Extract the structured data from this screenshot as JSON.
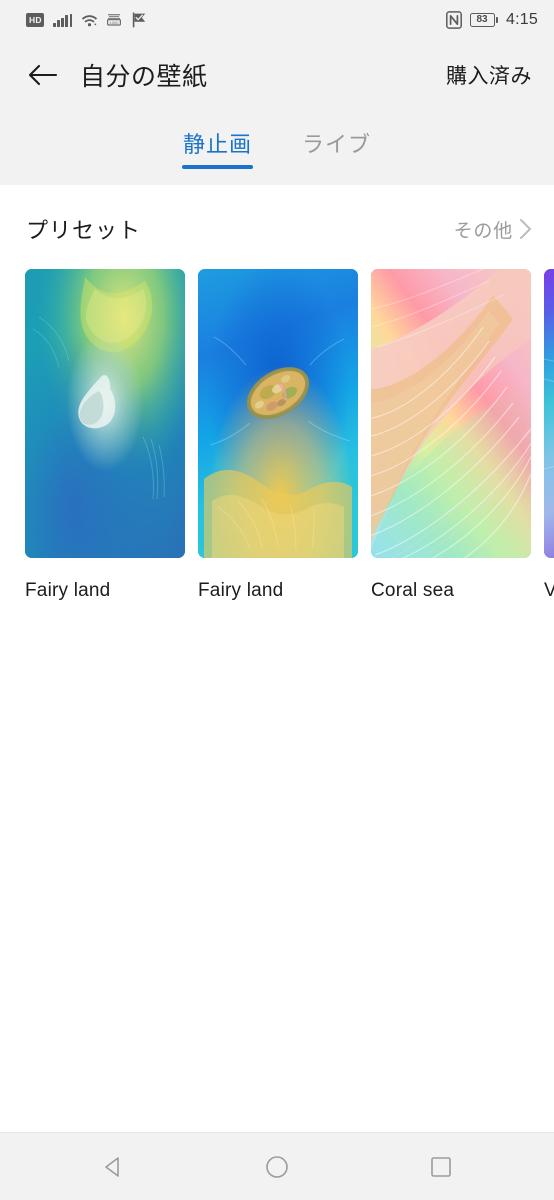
{
  "status_bar": {
    "hd_label": "HD",
    "icons": [
      "hd-badge",
      "signal-bars-icon",
      "wifi-icon",
      "vpn-key-icon",
      "flag-check-icon",
      "nfc-icon"
    ],
    "battery_percent": "83",
    "time": "4:15"
  },
  "app_bar": {
    "back_icon": "back-arrow-icon",
    "title": "自分の壁紙",
    "action_label": "購入済み"
  },
  "tabs": [
    {
      "label": "静止画",
      "active": true
    },
    {
      "label": "ライブ",
      "active": false
    }
  ],
  "section": {
    "title": "プリセット",
    "more_label": "その他",
    "more_icon": "chevron-right-icon"
  },
  "wallpapers": [
    {
      "label": "Fairy land",
      "theme": "teal-ocean"
    },
    {
      "label": "Fairy land",
      "theme": "blue-island"
    },
    {
      "label": "Coral sea",
      "theme": "pastel-rainbow"
    },
    {
      "label": "V",
      "theme": "violet-gradient"
    }
  ],
  "nav_bar": {
    "back": "nav-back-icon",
    "home": "nav-home-icon",
    "recents": "nav-recents-icon"
  },
  "colors": {
    "accent": "#1a73c9",
    "chrome": "#f2f2f2",
    "text": "#1c1c1c",
    "muted": "#9a9a9a"
  }
}
